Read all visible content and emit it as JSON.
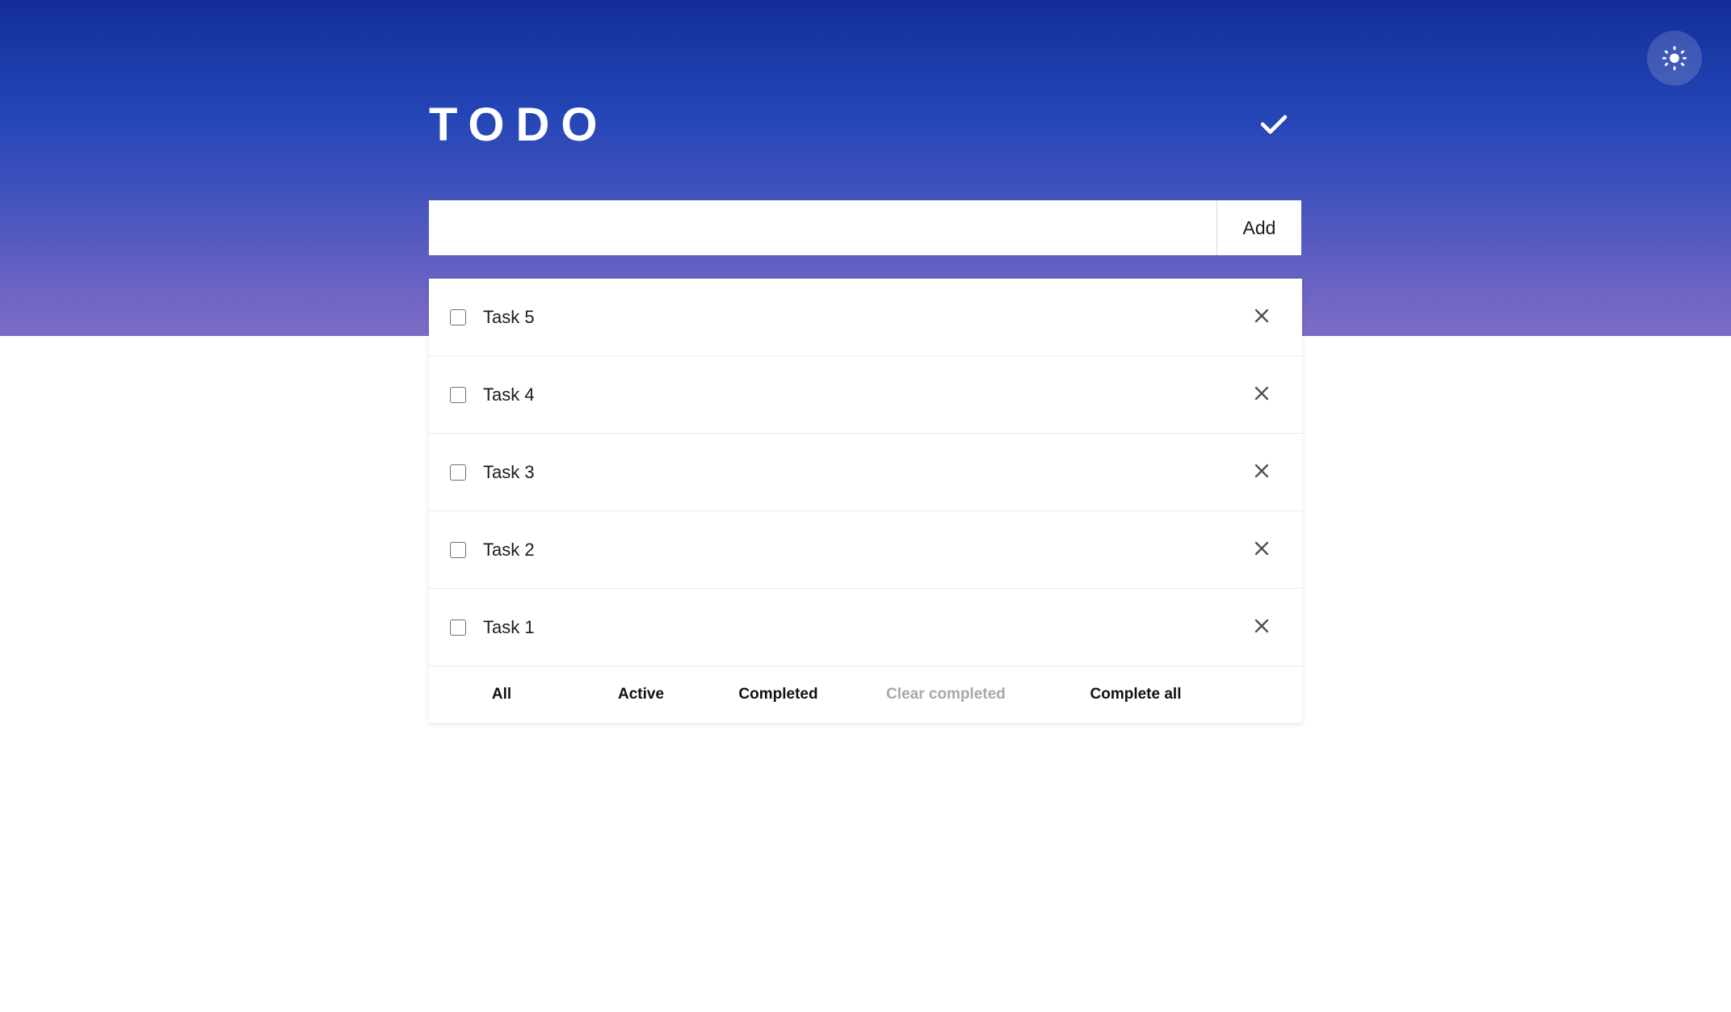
{
  "app": {
    "title": "TODO",
    "header_icon": "check-icon",
    "theme_toggle_icon": "sun-icon"
  },
  "add": {
    "value": "",
    "placeholder": "",
    "button_label": "Add"
  },
  "tasks": [
    {
      "label": "Task 5",
      "checked": false,
      "delete_icon": "close-icon"
    },
    {
      "label": "Task 4",
      "checked": false,
      "delete_icon": "close-icon"
    },
    {
      "label": "Task 3",
      "checked": false,
      "delete_icon": "close-icon"
    },
    {
      "label": "Task 2",
      "checked": false,
      "delete_icon": "close-icon"
    },
    {
      "label": "Task 1",
      "checked": false,
      "delete_icon": "close-icon"
    }
  ],
  "footer": {
    "all": "All",
    "active": "Active",
    "completed": "Completed",
    "clear_completed": "Clear completed",
    "complete_all": "Complete all"
  },
  "colors": {
    "gradient_top": "#132d98",
    "gradient_bottom": "#7e6dc6",
    "card_background": "#ffffff",
    "text_primary": "#1b1b1b",
    "text_disabled": "#a8a8a8",
    "divider": "#e9e9e9"
  }
}
